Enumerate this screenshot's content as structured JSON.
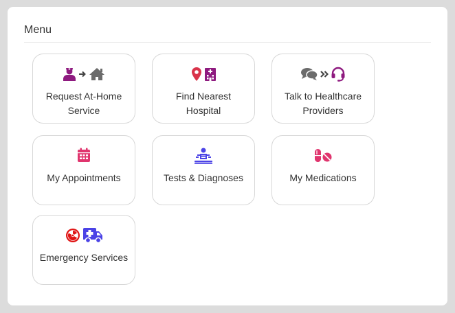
{
  "menu": {
    "title": "Menu",
    "items": [
      {
        "label_lines": [
          "Request At-Home",
          "Service"
        ],
        "icons": [
          "nurse-icon",
          "arrow-right-icon",
          "home-icon"
        ]
      },
      {
        "label_lines": [
          "Find Nearest",
          "Hospital"
        ],
        "icons": [
          "map-pin-icon",
          "hospital-icon"
        ]
      },
      {
        "label_lines": [
          "Talk to Healthcare",
          "Providers"
        ],
        "icons": [
          "chat-icon",
          "double-chevron-icon",
          "headset-icon"
        ]
      },
      {
        "label_lines": [
          "My Appointments"
        ],
        "icons": [
          "calendar-icon"
        ]
      },
      {
        "label_lines": [
          "Tests & Diagnoses"
        ],
        "icons": [
          "x-ray-icon"
        ]
      },
      {
        "label_lines": [
          "My Medications"
        ],
        "icons": [
          "pills-icon"
        ]
      },
      {
        "label_lines": [
          "Emergency Services"
        ],
        "icons": [
          "radiation-icon",
          "ambulance-icon"
        ]
      }
    ]
  },
  "colors": {
    "purple": "#8e1a7f",
    "gray": "#6b6b6b",
    "red": "#d9334a",
    "blue": "#4b43e6",
    "pink": "#e0356e",
    "emergency_red": "#e01414"
  }
}
